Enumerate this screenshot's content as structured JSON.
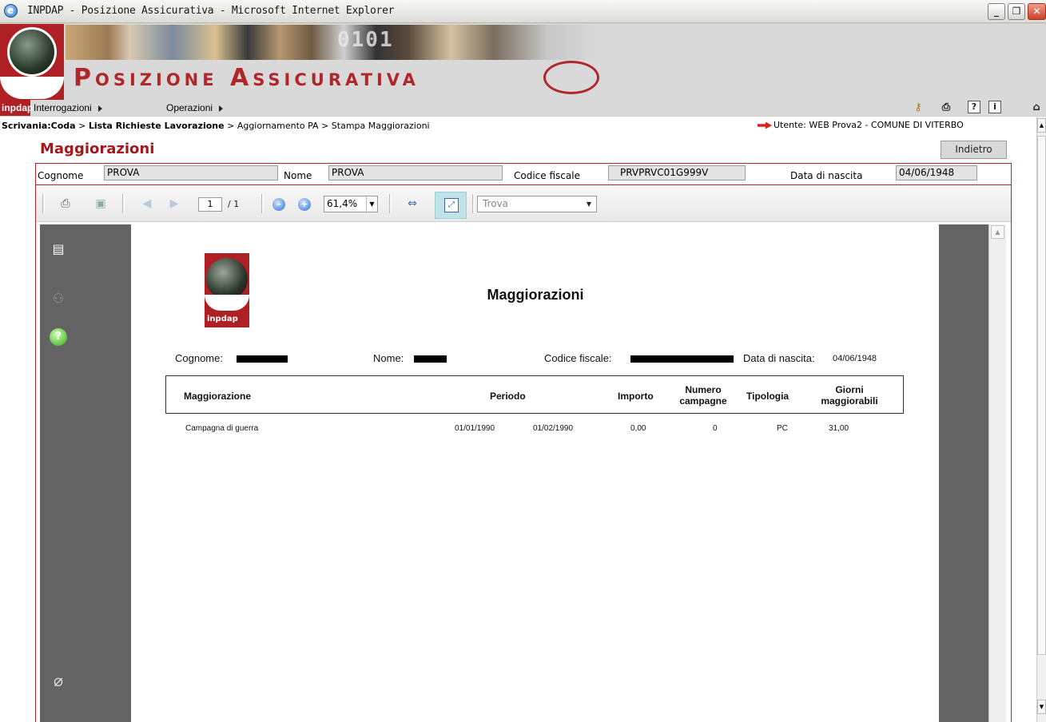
{
  "window": {
    "title": "INPDAP - Posizione Assicurativa - Microsoft Internet Explorer",
    "min": "_",
    "max": "❐",
    "close": "✕"
  },
  "banner": {
    "app_title": "Posizione Assicurativa",
    "photo_text": "0101",
    "brand": "inpdap"
  },
  "menu": {
    "items": [
      {
        "label": "Interrogazioni"
      },
      {
        "label": "Operazioni"
      }
    ]
  },
  "toolbar_icons": [
    "key-icon",
    "print-icon",
    "help-icon",
    "info-icon",
    "home-icon"
  ],
  "breadcrumb": {
    "root": "Scrivania:Coda",
    "sep1": " > ",
    "b2": "Lista Richieste Lavorazione",
    "rest": " > Aggiornamento PA > Stampa Maggiorazioni"
  },
  "user": {
    "text": "Utente: WEB Prova2 - COMUNE DI VITERBO"
  },
  "page": {
    "title": "Maggiorazioni",
    "back_label": "Indietro"
  },
  "fields": {
    "cognome_label": "Cognome",
    "cognome_value": "PROVA",
    "nome_label": "Nome",
    "nome_value": "PROVA",
    "cf_label": "Codice fiscale",
    "cf_value": "PRVPRVC01G999V",
    "dn_label": "Data di nascita",
    "dn_value": "04/06/1948"
  },
  "viewer": {
    "page_current": "1",
    "page_total": "/ 1",
    "zoom": "61,4%",
    "search_placeholder": "Trova"
  },
  "document": {
    "logo_text": "inpdap",
    "title": "Maggiorazioni",
    "lbl_cognome": "Cognome:",
    "lbl_nome": "Nome:",
    "lbl_cf": "Codice fiscale:",
    "lbl_dn": "Data di nascita:",
    "val_dn": "04/06/1948",
    "headers": {
      "maggiorazione": "Maggiorazione",
      "periodo": "Periodo",
      "importo": "Importo",
      "numero_campagne": "Numero campagne",
      "tipologia": "Tipologia",
      "giorni": "Giorni maggiorabili"
    },
    "rows": [
      {
        "maggiorazione": "Campagna di guerra",
        "dal": "01/01/1990",
        "al": "01/02/1990",
        "importo": "0,00",
        "numero_campagne": "0",
        "tipologia": "PC",
        "giorni": "31,00"
      }
    ]
  }
}
